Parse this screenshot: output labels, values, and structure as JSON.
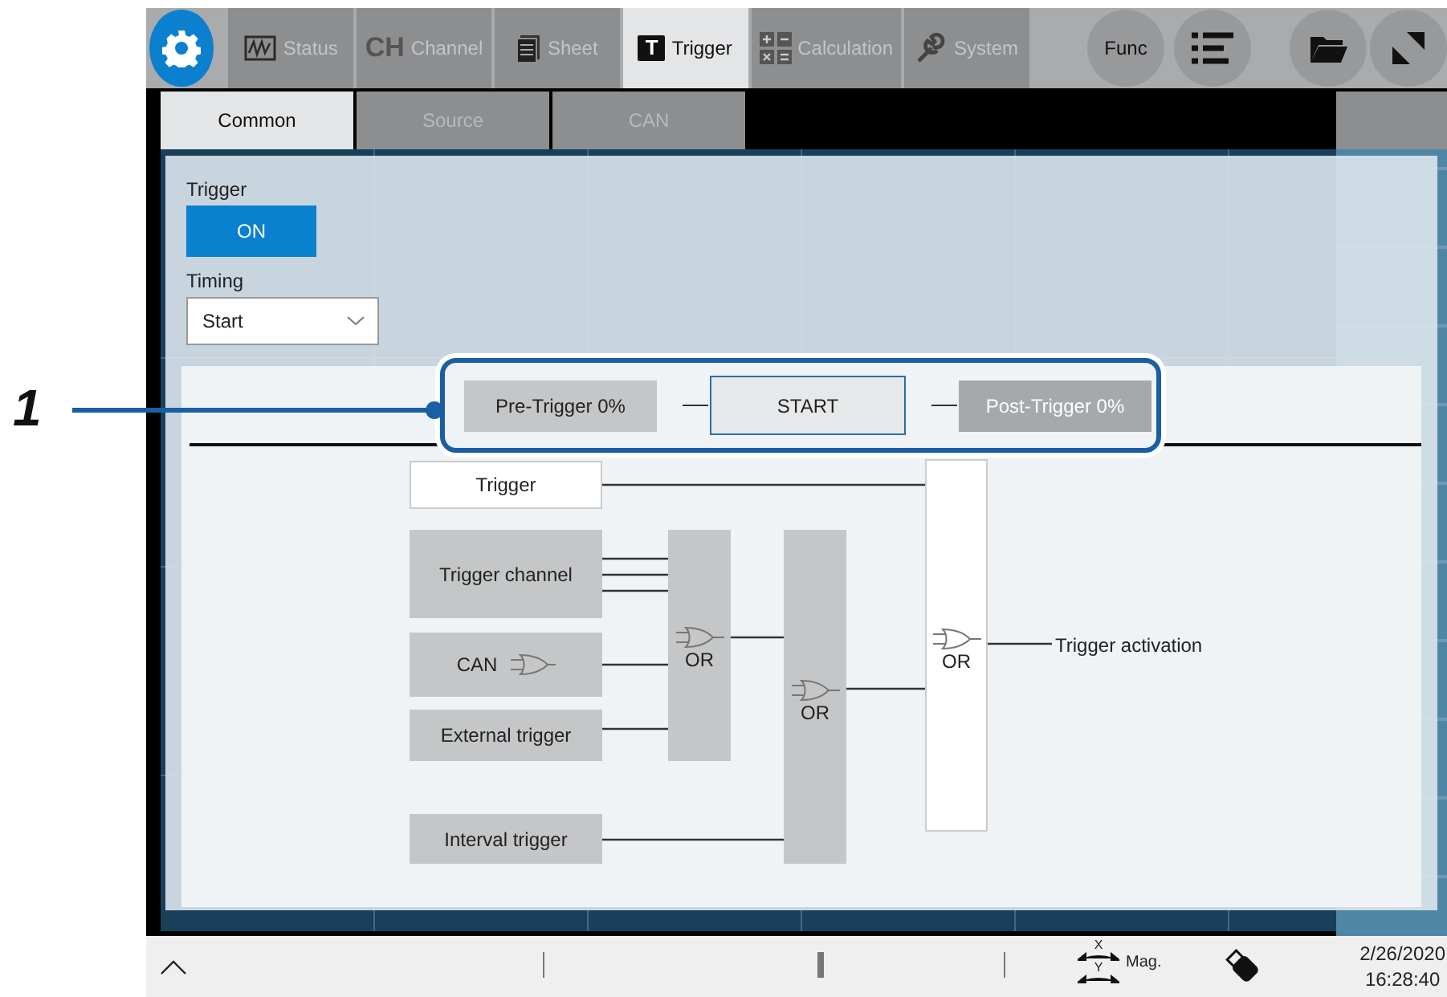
{
  "callout": {
    "number": "1"
  },
  "toolbar": {
    "tabs": [
      {
        "label": "Status",
        "kind": "wave",
        "selected": false
      },
      {
        "label": "Channel",
        "kind": "text",
        "icon_text": "CH",
        "selected": false
      },
      {
        "label": "Sheet",
        "kind": "sheet",
        "selected": false
      },
      {
        "label": "Trigger",
        "kind": "trigger",
        "icon_text": "T",
        "selected": true
      },
      {
        "label": "Calculation",
        "kind": "calc",
        "selected": false
      },
      {
        "label": "System",
        "kind": "wrench",
        "selected": false
      }
    ],
    "round_buttons": [
      {
        "kind": "text",
        "label": "Func"
      },
      {
        "kind": "list"
      },
      {
        "kind": "folder"
      },
      {
        "kind": "resize"
      }
    ]
  },
  "sub_tabs": [
    {
      "label": "Common",
      "selected": true
    },
    {
      "label": "Source",
      "selected": false
    },
    {
      "label": "CAN",
      "selected": false
    }
  ],
  "trigger_panel": {
    "trigger_label": "Trigger",
    "trigger_switch": {
      "label": "ON",
      "on": true
    },
    "timing_label": "Timing",
    "timing": {
      "value": "Start"
    }
  },
  "timeline": [
    {
      "label": "Pre-Trigger 0%",
      "kind": "pre",
      "disabled": false
    },
    {
      "label": "START",
      "kind": "start",
      "disabled": false
    },
    {
      "label": "Post-Trigger 0%",
      "kind": "post",
      "disabled": true
    }
  ],
  "diagram": {
    "inputs": [
      {
        "label": "Trigger",
        "kind": "outline",
        "gate_icon": false
      },
      {
        "label": "Trigger channel",
        "kind": "filled",
        "gate_icon": false
      },
      {
        "label": "CAN",
        "kind": "filled",
        "gate_icon": true
      },
      {
        "label": "External trigger",
        "kind": "filled",
        "gate_icon": false
      },
      {
        "label": "Interval trigger",
        "kind": "filled",
        "gate_icon": false
      }
    ],
    "gates": [
      {
        "label": "OR",
        "kind": "filled"
      },
      {
        "label": "OR",
        "kind": "filled"
      },
      {
        "label": "OR",
        "kind": "outline"
      }
    ],
    "output": "Trigger activation"
  },
  "status_bar": {
    "mag_x": "X",
    "mag_y": "Y",
    "mag": "Mag.",
    "date": "2/26/2020",
    "time": "16:28:40"
  }
}
